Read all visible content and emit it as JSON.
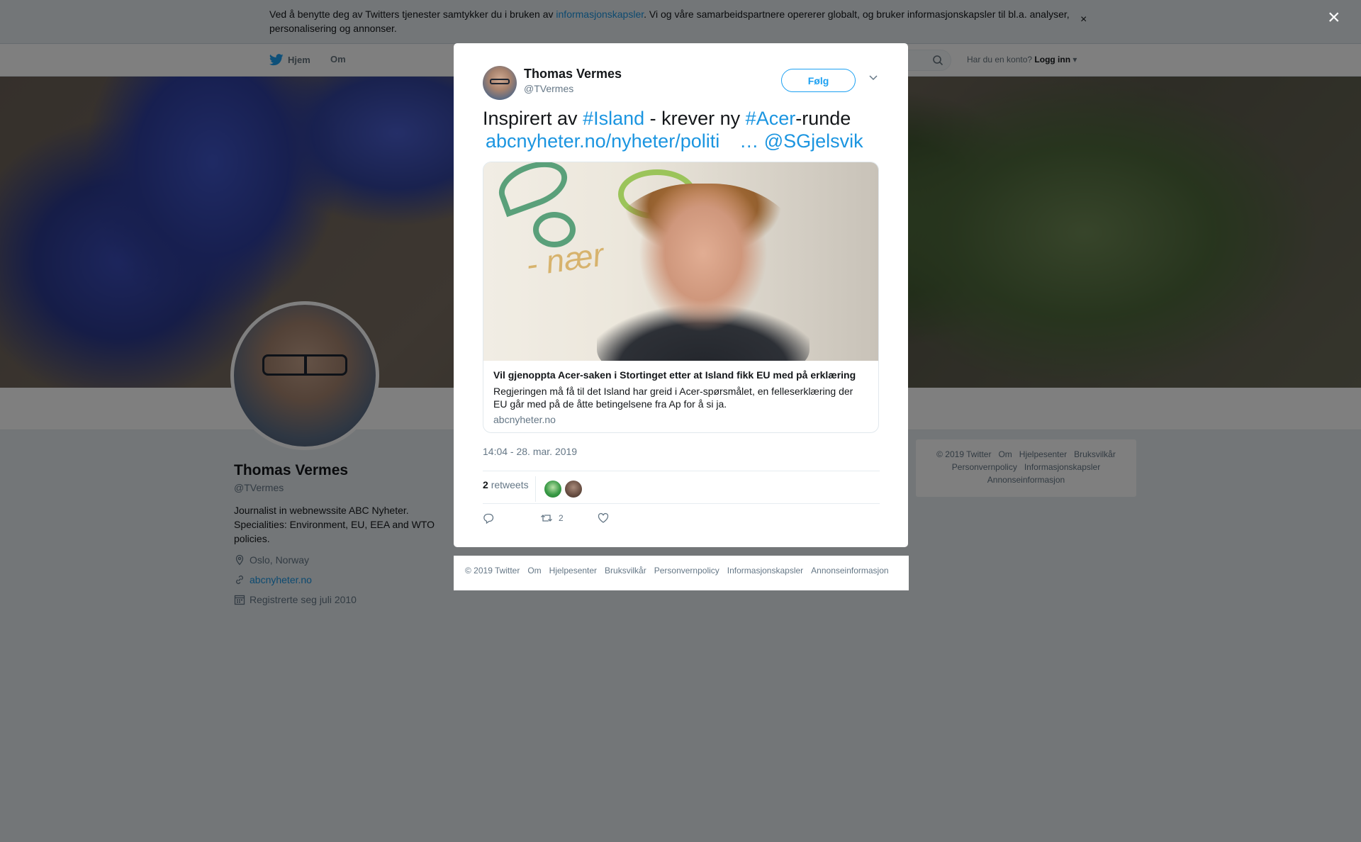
{
  "cookie": {
    "text_before": "Ved å benytte deg av Twitters tjenester samtykker du i bruken av ",
    "link": "informasjonskapsler",
    "text_after": ". Vi og våre samarbeidspartnere opererer globalt, og bruker informasjonskapsler til bl.a. analyser, personalisering og annonser.",
    "close": "×"
  },
  "nav": {
    "home": "Hjem",
    "about": "Om",
    "login_prompt": "Har du en konto?",
    "login": "Logg inn"
  },
  "profile": {
    "name": "Thomas Vermes",
    "handle": "@TVermes",
    "bio": "Journalist in webnewssite ABC Nyheter. Specialities: Environment, EU, EEA and WTO policies.",
    "location": "Oslo, Norway",
    "website": "abcnyheter.no",
    "joined": "Registrerte seg juli 2010"
  },
  "side_footer": [
    "© 2019 Twitter",
    "Om",
    "Hjelpesenter",
    "Bruksvilkår",
    "Personvernpolicy",
    "Informasjonskapsler",
    "Annonseinformasjon"
  ],
  "overlay_close": "×",
  "tweet": {
    "name": "Thomas Vermes",
    "handle": "@TVermes",
    "follow": "Følg",
    "text_1": "Inspirert av ",
    "hashtag_1": "#Island",
    "text_2": " - krever ny ",
    "hashtag_2": "#Acer",
    "text_3": "-runde",
    "url": "abcnyheter.no/nyheter/politi",
    "ellipsis": "…",
    "mention": "@SGjelsvik",
    "card": {
      "image_word": "- nær",
      "title": "Vil gjenoppta Acer-saken i Stortinget etter at Island fikk EU med på erklæring",
      "description": "Regjeringen må få til det Island har greid i Acer-spørsmålet, en felleserklæring der EU går med på de åtte betingelsene fra Ap for å si ja.",
      "domain": "abcnyheter.no"
    },
    "timestamp": "14:04 - 28. mar. 2019",
    "retweet_count": "2",
    "retweet_label": "retweets",
    "action_retweet_count": "2"
  },
  "modal_footer": [
    "© 2019 Twitter",
    "Om",
    "Hjelpesenter",
    "Bruksvilkår",
    "Personvernpolicy",
    "Informasjonskapsler",
    "Annonseinformasjon"
  ],
  "colors": {
    "twitter_blue": "#1da1f2",
    "link_blue": "#1b95e0",
    "secondary_text": "#657786"
  }
}
